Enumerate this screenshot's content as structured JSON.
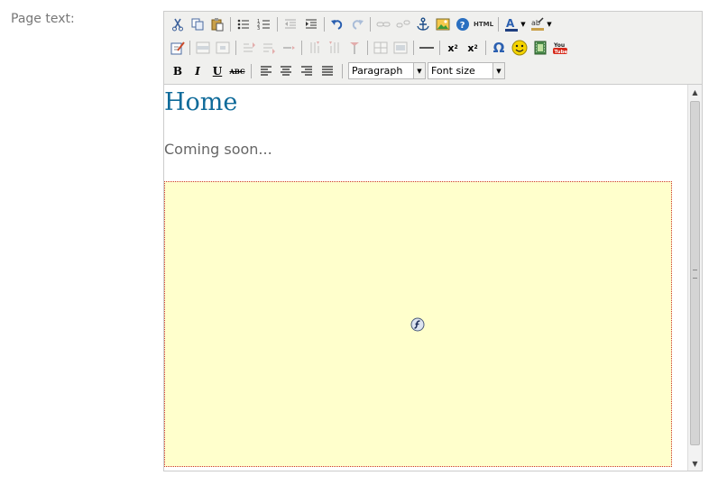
{
  "field": {
    "label": "Page text:"
  },
  "editor": {
    "content": {
      "heading": "Home",
      "paragraph": "Coming soon..."
    },
    "toolbar": {
      "row3": {
        "bold": "B",
        "italic": "I",
        "underline": "U",
        "strikethrough": "ABC",
        "format_select": "Paragraph",
        "fontsize_select": "Font size"
      },
      "row1": {
        "html_button": "HTML"
      },
      "row2": {
        "subscript": "x",
        "superscript": "x",
        "charmap": "Ω",
        "youtube": "You Tube"
      }
    }
  },
  "colors": {
    "heading": "#0f6b9a",
    "flash_bg": "#ffffcc",
    "toolbar_bg": "#f0f0ee"
  }
}
